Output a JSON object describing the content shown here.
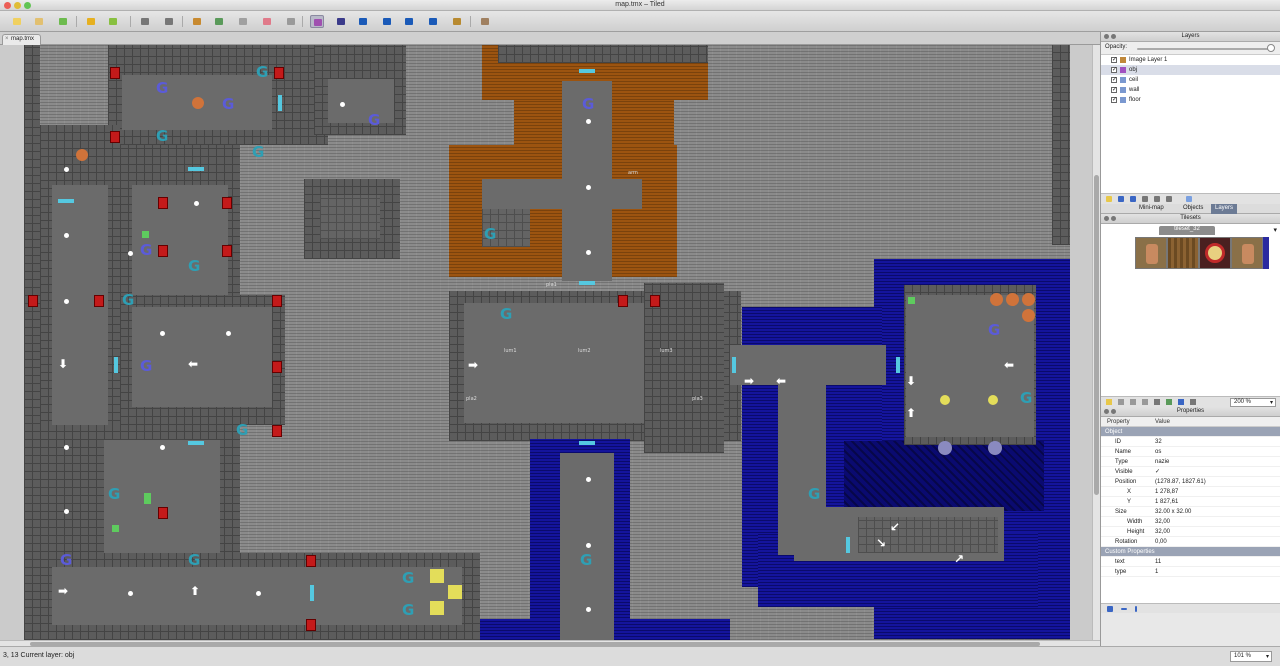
{
  "window": {
    "title": "map.tmx – Tiled"
  },
  "document_tab": {
    "label": "map.tmx"
  },
  "toolbar": {
    "tools": [
      {
        "name": "new-map-icon",
        "color": "#f0d060"
      },
      {
        "name": "open-map-icon",
        "color": "#e2c070"
      },
      {
        "name": "save-map-icon",
        "color": "#6dbb4e"
      },
      {
        "name": "undo-icon",
        "color": "#e6b020"
      },
      {
        "name": "redo-icon",
        "color": "#88c040"
      },
      {
        "name": "command-icon",
        "color": "#777777"
      },
      {
        "name": "random-mode-icon",
        "color": "#777777"
      },
      {
        "name": "stamp-brush-icon",
        "color": "#c88a30"
      },
      {
        "name": "terrain-brush-icon",
        "color": "#5a9a5a"
      },
      {
        "name": "bucket-fill-icon",
        "color": "#a0a0a0"
      },
      {
        "name": "eraser-icon",
        "color": "#e07a8a"
      },
      {
        "name": "rect-select-icon",
        "color": "#9a9a9a"
      },
      {
        "name": "magic-wand-icon",
        "color": "#a050b0"
      },
      {
        "name": "select-objects-icon",
        "color": "#3a3a8a"
      },
      {
        "name": "insert-rectangle-icon",
        "color": "#1a5ab8"
      },
      {
        "name": "insert-ellipse-icon",
        "color": "#1a5ab8"
      },
      {
        "name": "insert-polygon-icon",
        "color": "#1a5ab8"
      },
      {
        "name": "insert-polyline-icon",
        "color": "#1a5ab8"
      },
      {
        "name": "insert-tile-icon",
        "color": "#b88a30"
      },
      {
        "name": "settings-icon",
        "color": "#a08060"
      }
    ]
  },
  "layers_panel": {
    "title": "Layers",
    "opacity_label": "Opacity:",
    "opacity": 1.0,
    "layers": [
      {
        "name": "Image Layer 1",
        "visible": true,
        "selected": false,
        "icon": "image-layer-icon"
      },
      {
        "name": "obj",
        "visible": true,
        "selected": true,
        "icon": "object-layer-icon"
      },
      {
        "name": "ceil",
        "visible": true,
        "selected": false,
        "icon": "tile-layer-icon"
      },
      {
        "name": "wall",
        "visible": true,
        "selected": false,
        "icon": "tile-layer-icon"
      },
      {
        "name": "floor",
        "visible": true,
        "selected": false,
        "icon": "tile-layer-icon"
      }
    ],
    "tabs": [
      "Mini-map",
      "Objects",
      "Layers"
    ],
    "active_tab": "Layers"
  },
  "tilesets_panel": {
    "title": "Tilesets",
    "tileset_name": "tileset_32",
    "zoom": "200 %"
  },
  "properties_panel": {
    "title": "Properties",
    "col_property": "Property",
    "col_value": "Value",
    "rows": [
      {
        "kind": "group",
        "k": "Object",
        "v": ""
      },
      {
        "kind": "top",
        "k": "ID",
        "v": "32"
      },
      {
        "kind": "top",
        "k": "Name",
        "v": "os"
      },
      {
        "kind": "top",
        "k": "Type",
        "v": "nazie"
      },
      {
        "kind": "top",
        "k": "Visible",
        "v": "✓"
      },
      {
        "kind": "top",
        "k": "Position",
        "v": "(1278.87, 1827.61)"
      },
      {
        "kind": "sub",
        "k": "X",
        "v": "1 278,87"
      },
      {
        "kind": "sub",
        "k": "Y",
        "v": "1 827,61"
      },
      {
        "kind": "top",
        "k": "Size",
        "v": "32.00 x 32.00"
      },
      {
        "kind": "sub",
        "k": "Width",
        "v": "32,00"
      },
      {
        "kind": "sub",
        "k": "Height",
        "v": "32,00"
      },
      {
        "kind": "top",
        "k": "Rotation",
        "v": "0,00"
      },
      {
        "kind": "group",
        "k": "Custom Properties",
        "v": ""
      },
      {
        "kind": "top",
        "k": "text",
        "v": "11"
      },
      {
        "kind": "top",
        "k": "type",
        "v": "1"
      }
    ]
  },
  "map_labels": {
    "lum1": "lum1",
    "lum2": "lum2",
    "lum3": "lum3",
    "pla1": "pla1",
    "pla2": "pla2",
    "pla3": "pla3",
    "arm": "arm"
  },
  "statusbar": {
    "text": "3, 13 Current layer: obj",
    "zoom": "101 %"
  }
}
